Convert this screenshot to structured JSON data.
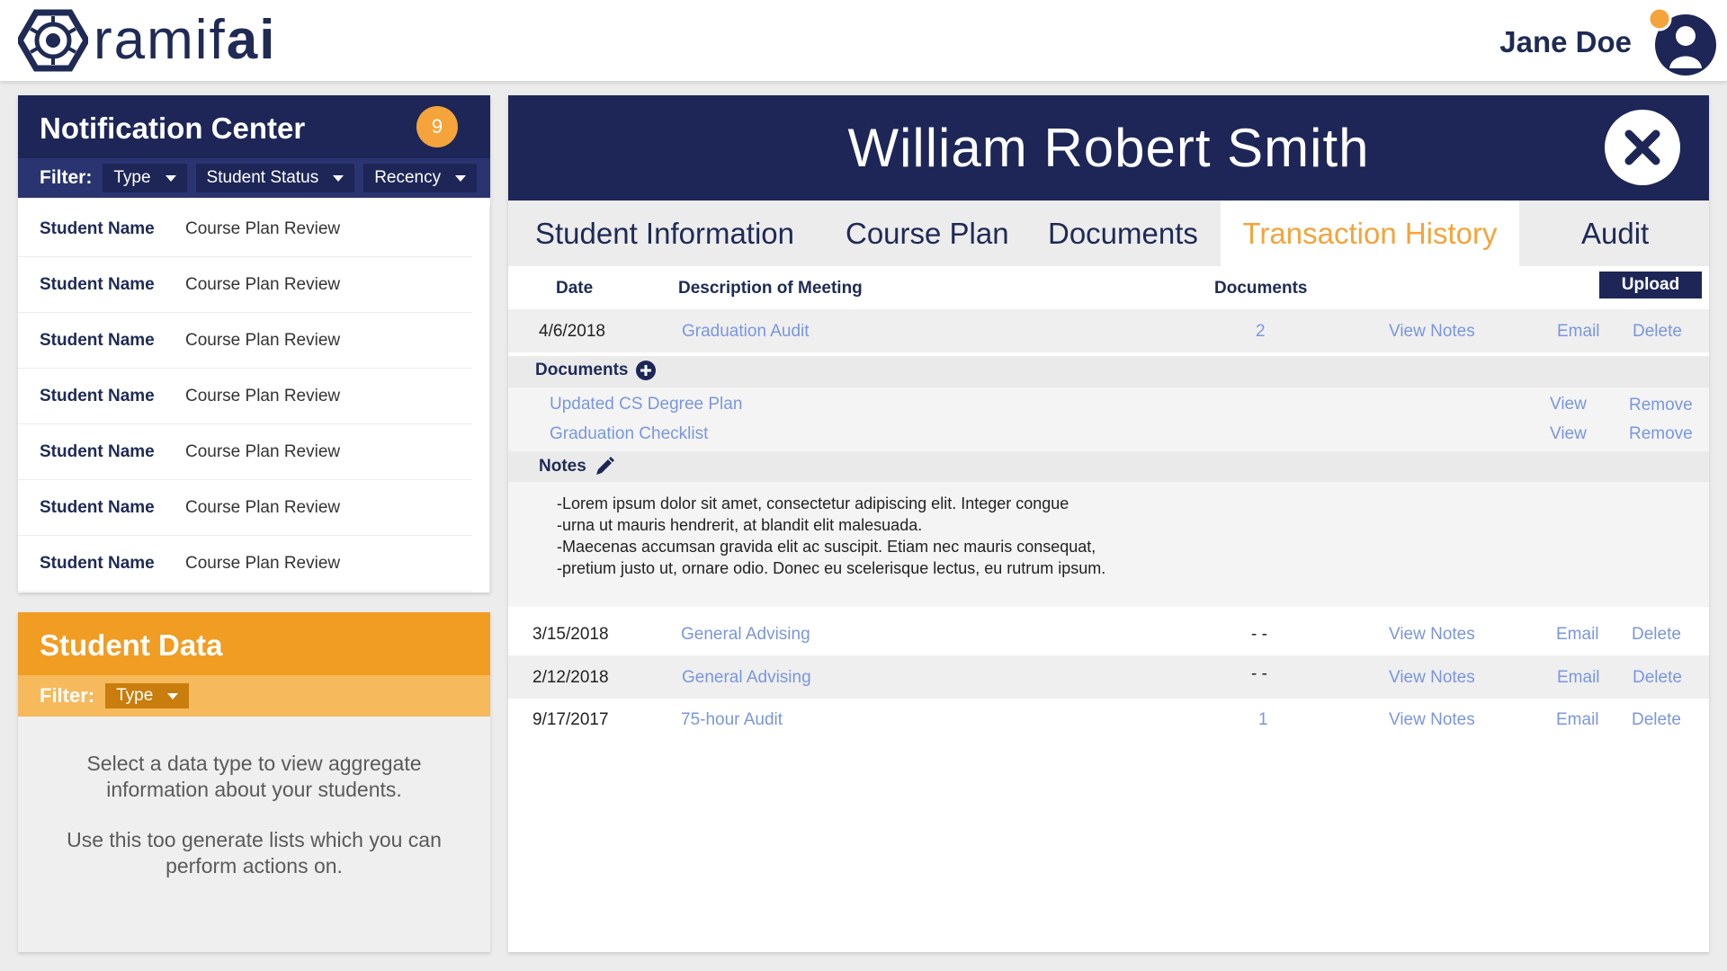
{
  "header": {
    "logo_text_light": "ramif",
    "logo_text_bold": "ai",
    "user_name": "Jane Doe"
  },
  "notification_center": {
    "title": "Notification Center",
    "badge_count": "9",
    "filter_label": "Filter:",
    "filters": [
      "Type",
      "Student Status",
      "Recency"
    ],
    "items": [
      {
        "name": "Student Name",
        "type": "Course Plan Review"
      },
      {
        "name": "Student Name",
        "type": "Course Plan Review"
      },
      {
        "name": "Student Name",
        "type": "Course Plan Review"
      },
      {
        "name": "Student Name",
        "type": "Course Plan Review"
      },
      {
        "name": "Student Name",
        "type": "Course Plan Review"
      },
      {
        "name": "Student Name",
        "type": "Course Plan Review"
      },
      {
        "name": "Student Name",
        "type": "Course Plan Review"
      }
    ]
  },
  "student_data": {
    "title": "Student Data",
    "filter_label": "Filter:",
    "filter_value": "Type",
    "body_line1": "Select a data type to view aggregate information about your students.",
    "body_line2": "Use this too generate lists which you can perform actions on."
  },
  "main": {
    "student_name": "William Robert Smith",
    "tabs": [
      "Student Information",
      "Course Plan",
      "Documents",
      "Transaction History",
      "Audit"
    ],
    "active_tab": "Transaction History",
    "columns": {
      "date": "Date",
      "description": "Description of Meeting",
      "documents": "Documents"
    },
    "upload_label": "Upload",
    "rows": [
      {
        "date": "4/6/2018",
        "description": "Graduation Audit",
        "documents": "2",
        "view_notes": "View Notes",
        "email": "Email",
        "delete": "Delete"
      },
      {
        "date": "3/15/2018",
        "description": "General Advising",
        "documents": "- -",
        "view_notes": "View Notes",
        "email": "Email",
        "delete": "Delete"
      },
      {
        "date": "2/12/2018",
        "description": "General Advising",
        "documents": "- -",
        "view_notes": "View Notes",
        "email": "Email",
        "delete": "Delete"
      },
      {
        "date": "9/17/2017",
        "description": "75-hour Audit",
        "documents": "1",
        "view_notes": "View Notes",
        "email": "Email",
        "delete": "Delete"
      }
    ],
    "expanded": {
      "documents_label": "Documents",
      "docs": [
        {
          "name": "Updated CS Degree Plan",
          "view": "View",
          "remove": "Remove"
        },
        {
          "name": "Graduation Checklist",
          "view": "View",
          "remove": "Remove"
        }
      ],
      "notes_label": "Notes",
      "notes_lines": [
        "-Lorem ipsum dolor sit amet, consectetur adipiscing elit. Integer congue",
        "-urna ut mauris hendrerit, at blandit elit malesuada.",
        "-Maecenas accumsan gravida elit ac suscipit. Etiam nec mauris consequat,",
        "-pretium justo ut, ornare odio. Donec eu scelerisque lectus, eu rutrum ipsum."
      ]
    }
  },
  "colors": {
    "navy": "#1d2657",
    "orange": "#f19c22",
    "link": "#7a96dd"
  }
}
